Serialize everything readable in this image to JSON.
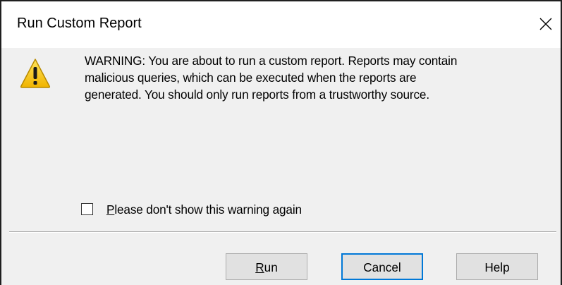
{
  "window": {
    "title": "Run Custom Report",
    "close_glyph": "close-icon"
  },
  "message": {
    "icon": "warning-icon",
    "lines": [
      "WARNING: You are about to run a custom report. Reports may contain",
      "malicious queries, which can be executed when the reports are",
      "generated. You should only run reports from a trustworthy source."
    ]
  },
  "checkbox": {
    "label_accel": "P",
    "label_rest": "lease don't show this warning again",
    "checked": false
  },
  "buttons": {
    "run_accel": "R",
    "run_rest": "un",
    "cancel": "Cancel",
    "help": "Help",
    "default_button": "Cancel"
  },
  "colors": {
    "dialog_bg": "#f0f0f0",
    "title_bg": "#ffffff",
    "button_bg": "#e1e1e1",
    "focus_border": "#0078d7",
    "warning_yellow": "#f5c400"
  }
}
